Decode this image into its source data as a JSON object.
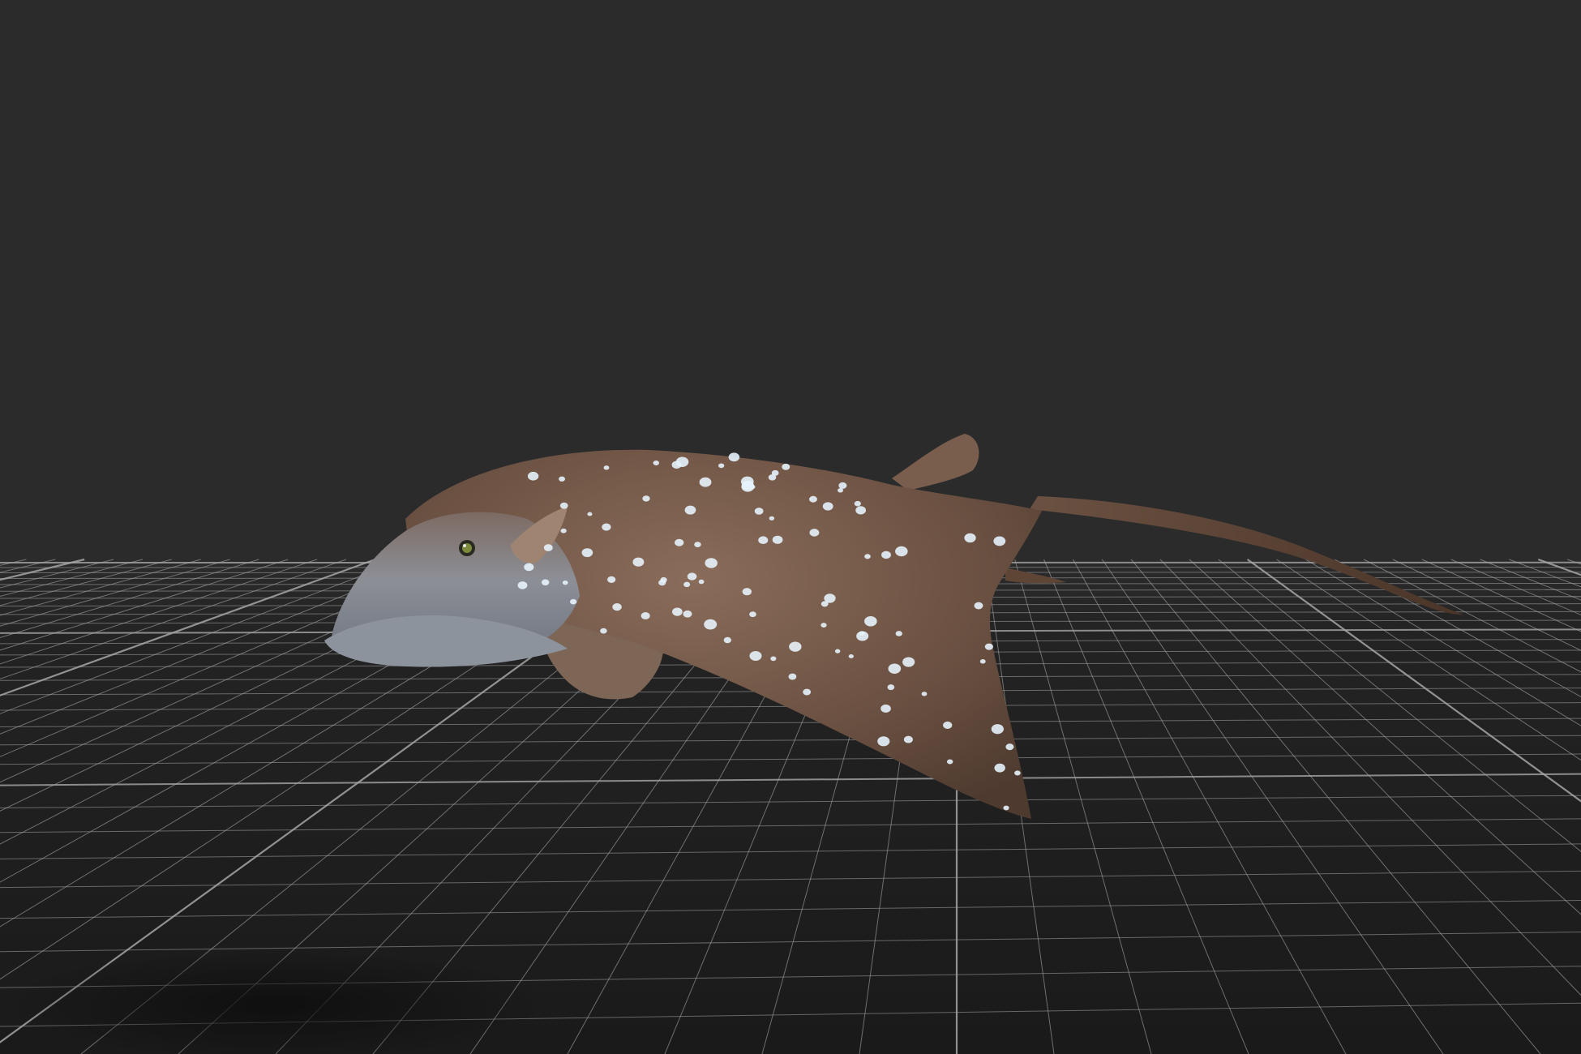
{
  "viewport": {
    "background_color": "#2b2b2b",
    "grid_line_color": "#a6a6a6",
    "grid_floor_color": "#1c1c1c",
    "grid_visible": true
  },
  "model": {
    "body_color": "#6e5444",
    "body_highlight_color": "#9a8070",
    "belly_color": "#8f9ba8",
    "spot_color": "#e6f2fb"
  }
}
